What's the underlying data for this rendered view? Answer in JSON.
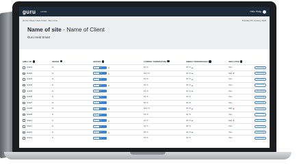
{
  "app": {
    "logo": "guru",
    "nav_home": "HOME",
    "user_label": "Hello Hinky"
  },
  "header": {
    "breadcrumb": "Home / Sites / Heat Smart - Site name",
    "date": "Tuesday 7th January 2020",
    "title_site": "Name of site",
    "title_sep": " - ",
    "title_client": "Name of Client",
    "subtitle": "Guru Heat Smart"
  },
  "table": {
    "headers": [
      "SMELL NO",
      "REGION",
      "HEATING",
      "CURRENT TEMPERATURE",
      "ENERGY PERFORMANCE",
      "INSULATION",
      ""
    ],
    "toggle_labels": {
      "off": "Off",
      "on": "On"
    },
    "button_label": "View Dwelling",
    "rows": [
      {
        "id": "Gha01",
        "region": "H",
        "temp": "18 °C",
        "energy": "32 °C",
        "insulation": "Vsm",
        "warn": true,
        "energy_up": true,
        "high": false
      },
      {
        "id": "Gha02",
        "region": "H",
        "temp": "18.2 °C",
        "energy": "32 °C",
        "insulation": "High",
        "warn": true,
        "energy_up": true,
        "high": true
      },
      {
        "id": "Gha03",
        "region": "H",
        "temp": "19 °C",
        "energy": "32 °C",
        "insulation": "Vsm",
        "warn": false,
        "energy_up": true,
        "high": false
      },
      {
        "id": "Gha04",
        "region": "H",
        "temp": "18 °C",
        "energy": "32 °C",
        "insulation": "Vsm",
        "warn": true,
        "energy_up": true,
        "high": false
      },
      {
        "id": "Gha05",
        "region": "H",
        "temp": "19 °C",
        "energy": "32 °C",
        "insulation": "Vsm",
        "warn": false,
        "energy_up": true,
        "high": false
      },
      {
        "id": "Gha06",
        "region": "H",
        "temp": "19 °C",
        "energy": "32 °C",
        "insulation": "Vsm",
        "warn": false,
        "energy_up": false,
        "high": false
      },
      {
        "id": "Gha07",
        "region": "H",
        "temp": "18 °C",
        "energy": "32 °C",
        "insulation": "Vsm",
        "warn": false,
        "energy_up": false,
        "high": false
      },
      {
        "id": "Gha08",
        "region": "H",
        "temp": "22.4 °C",
        "energy": "32 °C",
        "insulation": "High",
        "warn": true,
        "energy_up": true,
        "high": true
      },
      {
        "id": "Gha09",
        "region": "H",
        "temp": "19 °C",
        "energy": "32 °C",
        "insulation": "Vsm",
        "warn": false,
        "energy_up": false,
        "high": false
      },
      {
        "id": "Gha10",
        "region": "H",
        "temp": "21 °C",
        "energy": "32 °C",
        "insulation": "High",
        "warn": true,
        "energy_up": true,
        "high": true
      },
      {
        "id": "Gha11",
        "region": "H",
        "temp": "19 °C",
        "energy": "32 °C",
        "insulation": "Vsm",
        "warn": false,
        "energy_up": false,
        "high": false
      },
      {
        "id": "Gha12",
        "region": "H",
        "temp": "18 °C",
        "energy": "32 °C",
        "insulation": "Vsm",
        "warn": true,
        "energy_up": true,
        "high": false
      },
      {
        "id": "Gha13",
        "region": "H",
        "temp": "19 °C",
        "energy": "32 °C",
        "insulation": "Vsm",
        "warn": false,
        "energy_up": false,
        "high": false
      }
    ]
  },
  "colors": {
    "topbar": "#1d2a3a",
    "header_bg": "#eceef0",
    "accent": "#3b82d6",
    "warning": "#f0a020",
    "positive": "#2e9b57",
    "alert": "#d43a3a"
  }
}
